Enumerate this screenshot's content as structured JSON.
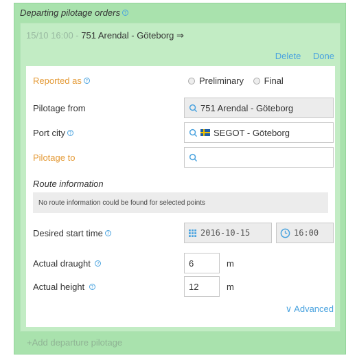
{
  "panel": {
    "title": "Departing pilotage orders"
  },
  "order": {
    "date": "15/10 16:00",
    "separator": " - ",
    "route": "751 Arendal - Göteborg",
    "arrow": "⇒",
    "delete_label": "Delete",
    "done_label": "Done"
  },
  "form": {
    "reported_as": {
      "label": "Reported as",
      "options": [
        "Preliminary",
        "Final"
      ]
    },
    "pilotage_from": {
      "label": "Pilotage from",
      "value": "751 Arendal - Göteborg"
    },
    "port_city": {
      "label": "Port city",
      "value": "SEGOT - Göteborg"
    },
    "pilotage_to": {
      "label": "Pilotage to",
      "value": ""
    },
    "route_info": {
      "label": "Route information",
      "message": "No route information could be found for selected points"
    },
    "desired_start": {
      "label": "Desired start time",
      "date": "2016-10-15",
      "time": "16:00"
    },
    "draught": {
      "label": "Actual draught",
      "value": "6",
      "unit": "m"
    },
    "height": {
      "label": "Actual height",
      "value": "12",
      "unit": "m"
    },
    "advanced_label": "Advanced",
    "advanced_chevron": "∨"
  },
  "add_departure": "+Add departure pilotage",
  "colors": {
    "panel_bg": "#a9e2ad",
    "order_bg": "#c2ecc4",
    "link": "#4aa3df",
    "required_label": "#e49a36"
  }
}
